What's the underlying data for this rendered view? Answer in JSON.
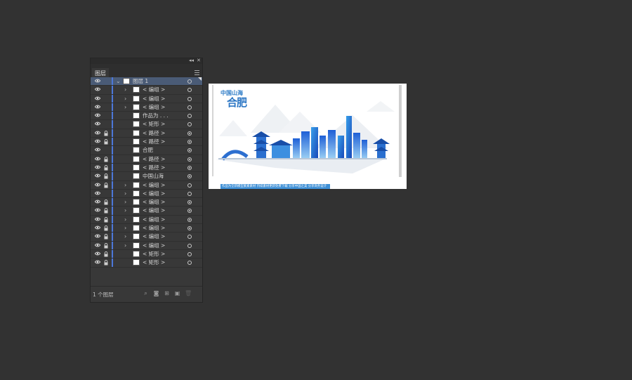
{
  "panel": {
    "tab_label": "图层",
    "footer_count": "1 个图层",
    "layers": [
      {
        "name": "图层 1",
        "level": "top",
        "expanded": true,
        "locked": false,
        "target": "ring",
        "selected": true
      },
      {
        "name": "< 编组 >",
        "level": "child",
        "chevron": true,
        "locked": false,
        "target": "ring"
      },
      {
        "name": "< 编组 >",
        "level": "child",
        "chevron": true,
        "locked": false,
        "target": "ring"
      },
      {
        "name": "< 编组 >",
        "level": "child",
        "chevron": true,
        "locked": false,
        "target": "ring"
      },
      {
        "name": "作品为 . . .",
        "level": "child",
        "chevron": false,
        "locked": false,
        "target": "ring"
      },
      {
        "name": "< 矩形 >",
        "level": "child",
        "chevron": false,
        "locked": false,
        "target": "ring"
      },
      {
        "name": "< 路径 >",
        "level": "child",
        "chevron": false,
        "locked": true,
        "target": "dot"
      },
      {
        "name": "< 路径 >",
        "level": "child",
        "chevron": false,
        "locked": true,
        "target": "dot"
      },
      {
        "name": "合肥",
        "level": "child",
        "chevron": false,
        "locked": false,
        "target": "dot"
      },
      {
        "name": "< 路径 >",
        "level": "child",
        "chevron": false,
        "locked": true,
        "target": "dot"
      },
      {
        "name": "< 路径 >",
        "level": "child",
        "chevron": false,
        "locked": true,
        "target": "dot"
      },
      {
        "name": "中国山海",
        "level": "child",
        "chevron": false,
        "locked": true,
        "target": "dot"
      },
      {
        "name": "< 编组 >",
        "level": "child",
        "chevron": true,
        "locked": true,
        "target": "ring"
      },
      {
        "name": "< 编组 >",
        "level": "child",
        "chevron": true,
        "locked": false,
        "target": "ring"
      },
      {
        "name": "< 编组 >",
        "level": "child",
        "chevron": true,
        "locked": true,
        "target": "dot"
      },
      {
        "name": "< 编组 >",
        "level": "child",
        "chevron": true,
        "locked": true,
        "target": "dot"
      },
      {
        "name": "< 编组 >",
        "level": "child",
        "chevron": true,
        "locked": true,
        "target": "dot"
      },
      {
        "name": "< 编组 >",
        "level": "child",
        "chevron": true,
        "locked": true,
        "target": "dot"
      },
      {
        "name": "< 编组 >",
        "level": "child",
        "chevron": true,
        "locked": true,
        "target": "ring"
      },
      {
        "name": "< 编组 >",
        "level": "child",
        "chevron": true,
        "locked": true,
        "target": "ring"
      },
      {
        "name": "< 矩形 >",
        "level": "child",
        "chevron": false,
        "locked": true,
        "target": "ring"
      },
      {
        "name": "< 矩形 >",
        "level": "child",
        "chevron": false,
        "locked": true,
        "target": "ring"
      }
    ]
  },
  "artboard": {
    "title_small": "中国山海",
    "title_large": "合肥",
    "caption": "作品为全新模型素素素材 持续素材更新免费下载 分享中国之美 分享商务设计"
  },
  "colors": {
    "app_bg": "#323232",
    "panel_bg": "#383838",
    "selected_row": "#4a5b76",
    "layer_color_bar": "#4c78d9",
    "art_blue": "#2b76c4"
  }
}
